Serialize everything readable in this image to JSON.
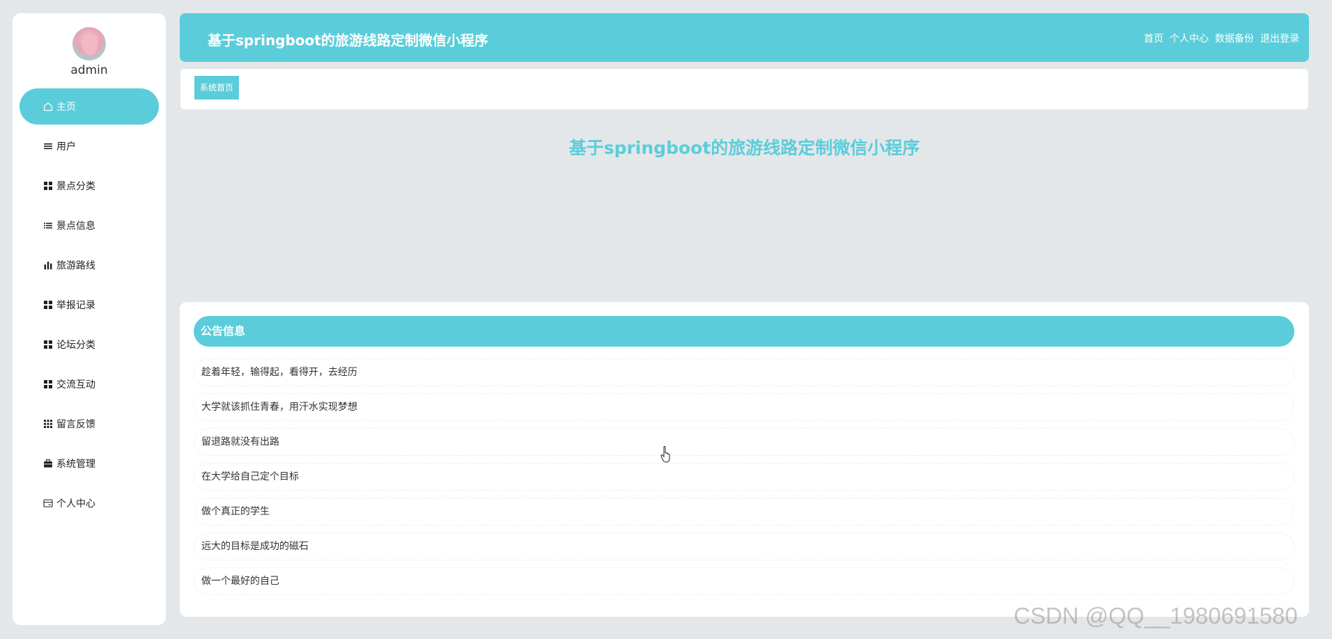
{
  "sidebar": {
    "username": "admin",
    "items": [
      {
        "label": "主页",
        "icon": "home-icon",
        "active": true
      },
      {
        "label": "用户",
        "icon": "list-icon"
      },
      {
        "label": "景点分类",
        "icon": "grid-icon"
      },
      {
        "label": "景点信息",
        "icon": "list-icon"
      },
      {
        "label": "旅游路线",
        "icon": "bar-chart-icon"
      },
      {
        "label": "举报记录",
        "icon": "grid-icon"
      },
      {
        "label": "论坛分类",
        "icon": "grid-icon"
      },
      {
        "label": "交流互动",
        "icon": "grid-icon"
      },
      {
        "label": "留言反馈",
        "icon": "apps-icon"
      },
      {
        "label": "系统管理",
        "icon": "briefcase-icon"
      },
      {
        "label": "个人中心",
        "icon": "card-icon"
      }
    ]
  },
  "header": {
    "title": "基于springboot的旅游线路定制微信小程序",
    "links": [
      "首页",
      "个人中心",
      "数据备份",
      "退出登录"
    ]
  },
  "breadcrumb": {
    "tag": "系统首页"
  },
  "main": {
    "welcome": "基于springboot的旅游线路定制微信小程序"
  },
  "notices": {
    "title": "公告信息",
    "items": [
      "趁着年轻，输得起，看得开，去经历",
      "大学就该抓住青春，用汗水实现梦想",
      "留退路就没有出路",
      "在大学给自己定个目标",
      "做个真正的学生",
      "远大的目标是成功的磁石",
      "做一个最好的自己"
    ]
  },
  "watermark": "CSDN @QQ__1980691580",
  "colors": {
    "accent": "#5bcdda",
    "background": "#e4e7e9"
  }
}
